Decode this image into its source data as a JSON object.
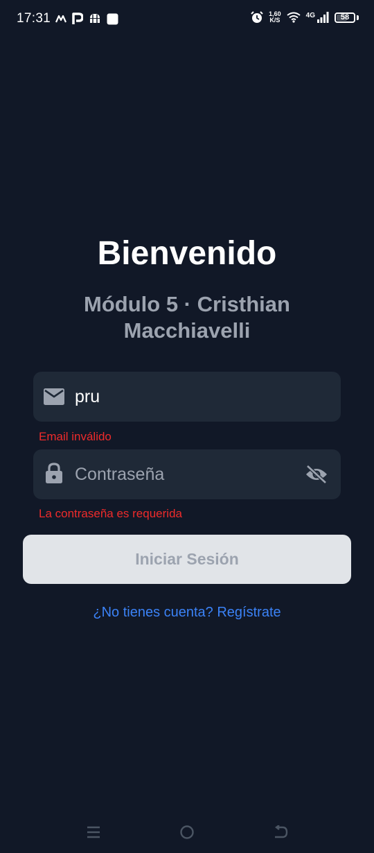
{
  "status_bar": {
    "time": "17:31",
    "net_speed_value": "1,60",
    "net_speed_unit": "K/S",
    "network_type": "4G",
    "battery": "58",
    "icons": [
      "notification-icon",
      "p-app-icon",
      "store-icon",
      "square-app-icon",
      "alarm-icon",
      "wifi-icon",
      "signal-icon",
      "battery-icon"
    ]
  },
  "header": {
    "title": "Bienvenido",
    "subtitle": "Módulo 5 · Cristhian Macchiavelli"
  },
  "form": {
    "email": {
      "value": "pru",
      "icon": "mail-icon",
      "error": "Email inválido"
    },
    "password": {
      "placeholder": "Contraseña",
      "icon": "lock-icon",
      "toggle_icon": "eye-off-icon",
      "error": "La contraseña es requerida"
    },
    "submit_label": "Iniciar Sesión",
    "register_link": "¿No tienes cuenta? Regístrate"
  },
  "nav_bar": {
    "items": [
      "menu-icon",
      "home-icon",
      "back-icon"
    ]
  },
  "colors": {
    "background": "#111827",
    "input_background": "#1f2937",
    "error": "#ef2b2b",
    "link": "#3b82f6",
    "button_disabled": "#e1e4e8",
    "muted_text": "#9ca3af"
  }
}
